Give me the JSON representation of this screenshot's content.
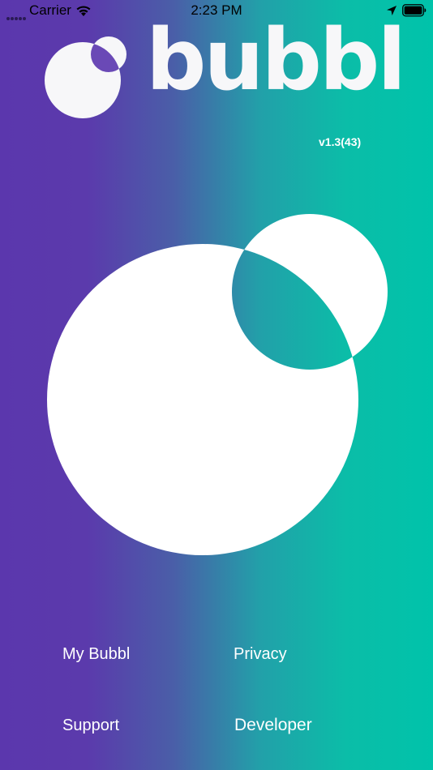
{
  "status_bar": {
    "carrier": "Carrier",
    "time": "2:23 PM"
  },
  "app": {
    "logo_text": "bubbl",
    "version": "v1.3(43)"
  },
  "menu": {
    "my_bubbl": "My Bubbl",
    "privacy": "Privacy",
    "support": "Support",
    "developer": "Developer"
  },
  "colors": {
    "gradient_left": "#5b37ad",
    "gradient_right": "#00c3aa",
    "bubble": "#ffffff"
  },
  "icons": {
    "wifi": "wifi-icon",
    "location": "location-arrow-icon",
    "battery": "battery-icon",
    "logo": "bubbl-logo-mark-icon"
  }
}
